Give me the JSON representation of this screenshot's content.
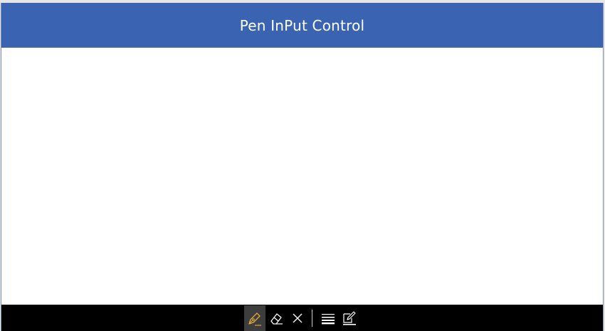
{
  "header": {
    "title": "Pen InPut Control"
  },
  "toolbar": {
    "tools": [
      {
        "icon": "pen-icon",
        "active": true
      },
      {
        "icon": "eraser-icon",
        "active": false
      },
      {
        "icon": "close-icon",
        "active": false
      },
      {
        "icon": "stroke-width-icon",
        "active": false
      },
      {
        "icon": "pen-color-icon",
        "active": false
      }
    ]
  },
  "colors": {
    "header_bg": "#3a64b2",
    "toolbar_bg": "#000000",
    "active_pen": "#d9a441",
    "icon": "#ffffff"
  }
}
